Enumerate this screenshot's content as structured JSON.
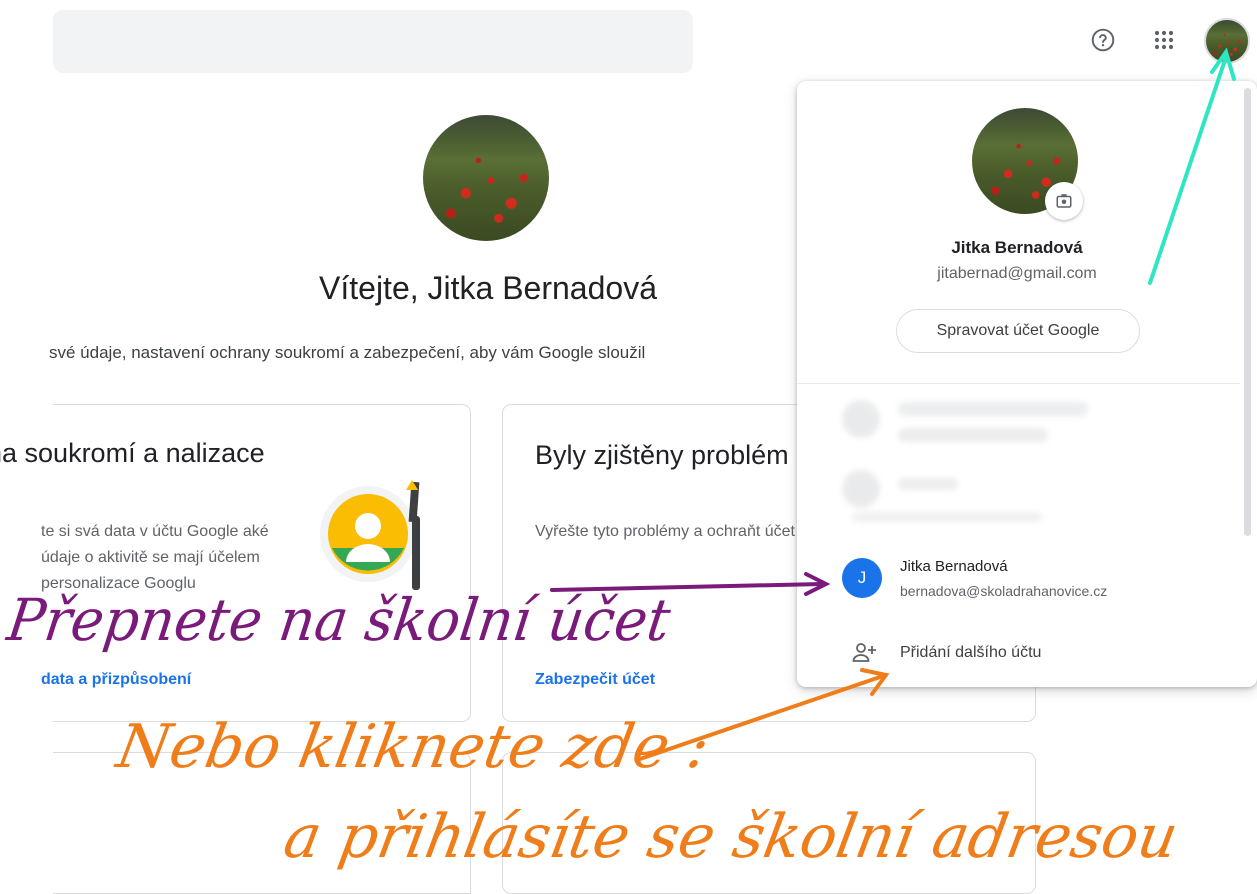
{
  "header": {
    "search_value": "",
    "help_icon": "help-circle-icon",
    "apps_icon": "apps-grid-icon"
  },
  "main": {
    "welcome": "Vítejte, Jitka Bernadová",
    "subtitle": "své údaje, nastavení ochrany soukromí a zabezpečení, aby vám Google sloužil",
    "cards": [
      {
        "title": "na soukromí a nalizace",
        "text": "te si svá data v účtu Google aké údaje o aktivitě se mají účelem personalizace Googlu",
        "link": "data a přizpůsobení"
      },
      {
        "title": "Byly zjištěny problém se zabezpečením",
        "text": "Vyřešte tyto problémy a ochraňt účet",
        "link": "Zabezpečit účet"
      }
    ]
  },
  "panel": {
    "name": "Jitka Bernadová",
    "email": "jitabernad@gmail.com",
    "manage_button": "Spravovat účet Google",
    "accounts": [
      {
        "initial": "J",
        "name": "Jitka Bernadová",
        "email": "bernadova@skoladrahanovice.cz",
        "color": "#1a73e8"
      }
    ],
    "add_account": "Přidání dalšího účtu"
  },
  "annotations": {
    "purple": "Přepnete na školní účet",
    "orange_line1": "Nebo kliknete zde :",
    "orange_line2": "a přihlásíte se školní adresou",
    "colors": {
      "purple": "#7a1a7a",
      "orange": "#ef7d1a",
      "teal": "#2ee6c4"
    }
  }
}
